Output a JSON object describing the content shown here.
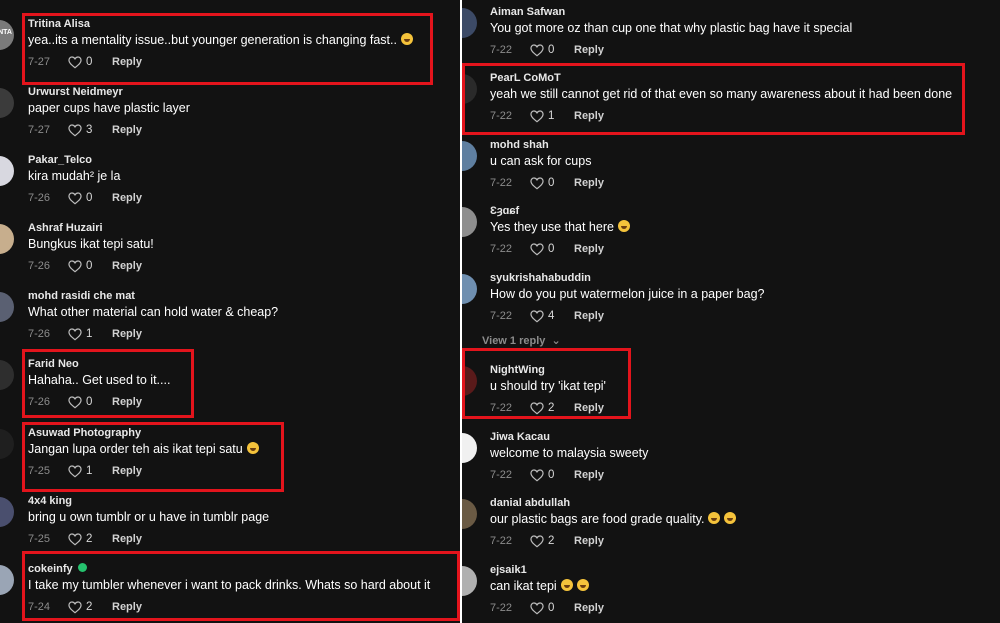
{
  "left_comments": [
    {
      "username": "Tritina Alisa",
      "text": "yea..its a mentality issue..but younger generation is changing fast..",
      "emoji": true,
      "date": "7-27",
      "likes": "0",
      "reply": "Reply",
      "avatar_color": "#7a7a7a",
      "avatar_text": "NTA"
    },
    {
      "username": "Urwurst Neidmeyr",
      "text": "paper cups have plastic layer",
      "date": "7-27",
      "likes": "3",
      "reply": "Reply",
      "avatar_color": "#3b3b3b"
    },
    {
      "username": "Pakar_Telco",
      "text": "kira mudah² je la",
      "date": "7-26",
      "likes": "0",
      "reply": "Reply",
      "avatar_color": "#d8d8e0"
    },
    {
      "username": "Ashraf Huzairi",
      "text": "Bungkus ikat tepi satu!",
      "date": "7-26",
      "likes": "0",
      "reply": "Reply",
      "avatar_color": "#c7ae8d"
    },
    {
      "username": "mohd rasidi che mat",
      "text": "What other material can hold water & cheap?",
      "date": "7-26",
      "likes": "1",
      "reply": "Reply",
      "avatar_color": "#5a6072"
    },
    {
      "username": "Farid Neo",
      "text": "Hahaha.. Get used to it....",
      "date": "7-26",
      "likes": "0",
      "reply": "Reply",
      "avatar_color": "#2e2e2e"
    },
    {
      "username": "Asuwad Photography",
      "text": "Jangan lupa order teh ais ikat tepi satu",
      "emoji": true,
      "date": "7-25",
      "likes": "1",
      "reply": "Reply",
      "avatar_color": "#1f1f1f"
    },
    {
      "username": "4x4 king",
      "text": "bring u own tumblr or u have in tumblr page",
      "date": "7-25",
      "likes": "2",
      "reply": "Reply",
      "avatar_color": "#4a4f6e"
    },
    {
      "username": "cokeinfy",
      "verified": true,
      "text": "I take my tumbler whenever i want to pack drinks. Whats so hard about it",
      "date": "7-24",
      "likes": "2",
      "reply": "Reply",
      "avatar_color": "#9aa5b5"
    }
  ],
  "right_comments": [
    {
      "username": "Aiman Safwan",
      "text": "You got more oz than cup one that why plastic bag have it special",
      "date": "7-22",
      "likes": "0",
      "reply": "Reply",
      "avatar_color": "#3c4a66"
    },
    {
      "username": "PearL CoMoT",
      "text": "yeah we still cannot get rid of that even so many awareness about it had been done",
      "date": "7-22",
      "likes": "1",
      "reply": "Reply",
      "avatar_color": "#2a2a2a"
    },
    {
      "username": "mohd shah",
      "text": "u can ask for cups",
      "date": "7-22",
      "likes": "0",
      "reply": "Reply",
      "avatar_color": "#5f7fa0"
    },
    {
      "username": "Ɛȝɑɕf",
      "text": "Yes they use that here",
      "emoji": true,
      "date": "7-22",
      "likes": "0",
      "reply": "Reply",
      "avatar_color": "#8e8e8e"
    },
    {
      "username": "syukrishahabuddin",
      "text": "How do you put watermelon juice in a paper bag?",
      "date": "7-22",
      "likes": "4",
      "reply": "Reply",
      "avatar_color": "#6f8fb0"
    },
    {
      "username": "NightWing",
      "text": "u should try 'ikat tepi'",
      "date": "7-22",
      "likes": "2",
      "reply": "Reply",
      "avatar_color": "#5a1a1a"
    },
    {
      "username": "Jiwa Kacau",
      "text": "welcome to malaysia sweety",
      "date": "7-22",
      "likes": "0",
      "reply": "Reply",
      "avatar_color": "#f0f0f0"
    },
    {
      "username": "danial abdullah",
      "text": "our plastic bags are food grade quality.",
      "emoji": true,
      "emoji2": true,
      "date": "7-22",
      "likes": "2",
      "reply": "Reply",
      "avatar_color": "#6a5a44"
    },
    {
      "username": "ejsaik1",
      "text": "can ikat tepi",
      "emoji": true,
      "emoji2": true,
      "date": "7-22",
      "likes": "0",
      "reply": "Reply",
      "avatar_color": "#b0b0b0"
    }
  ],
  "view_replies": "View 1 reply",
  "colors": {
    "highlight": "#e3141c",
    "background": "#121212",
    "verified": "#25c26e"
  }
}
